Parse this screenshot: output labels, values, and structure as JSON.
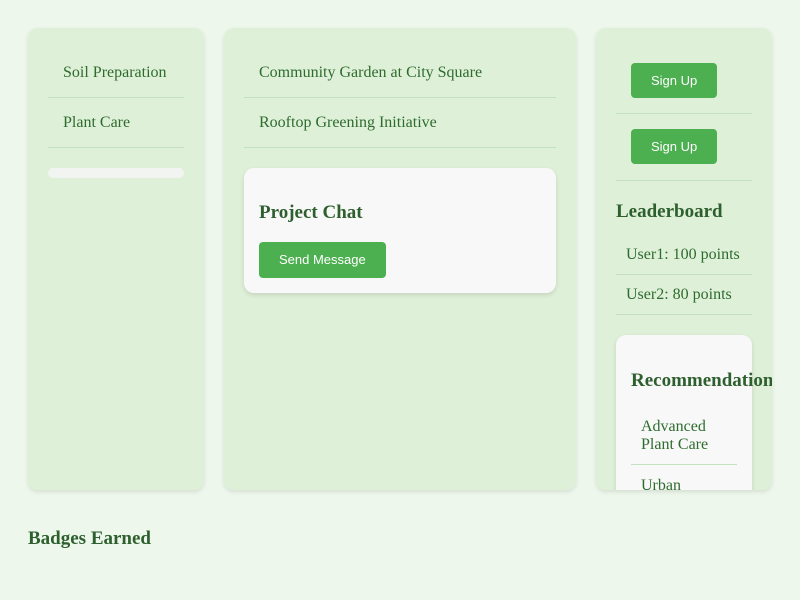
{
  "left_panel": {
    "items": [
      {
        "label": "Soil Preparation"
      },
      {
        "label": "Plant Care"
      }
    ],
    "progress": 0
  },
  "middle_panel": {
    "projects": [
      {
        "label": "Community Garden at City Square"
      },
      {
        "label": "Rooftop Greening Initiative"
      }
    ],
    "chat": {
      "heading": "Project Chat",
      "send_label": "Send Message"
    }
  },
  "right_panel": {
    "signup_buttons": [
      {
        "label": "Sign Up"
      },
      {
        "label": "Sign Up"
      }
    ],
    "leaderboard": {
      "heading": "Leaderboard",
      "entries": [
        "User1: 100 points",
        "User2: 80 points"
      ]
    },
    "recommendations": {
      "heading": "Recommendations",
      "items": [
        "Advanced Plant Care",
        "Urban"
      ]
    }
  },
  "badges": {
    "heading": "Badges Earned"
  },
  "colors": {
    "background": "#eef7ec",
    "panel": "#dff0d8",
    "accent": "#4caf50",
    "text": "#2e6b2e"
  }
}
